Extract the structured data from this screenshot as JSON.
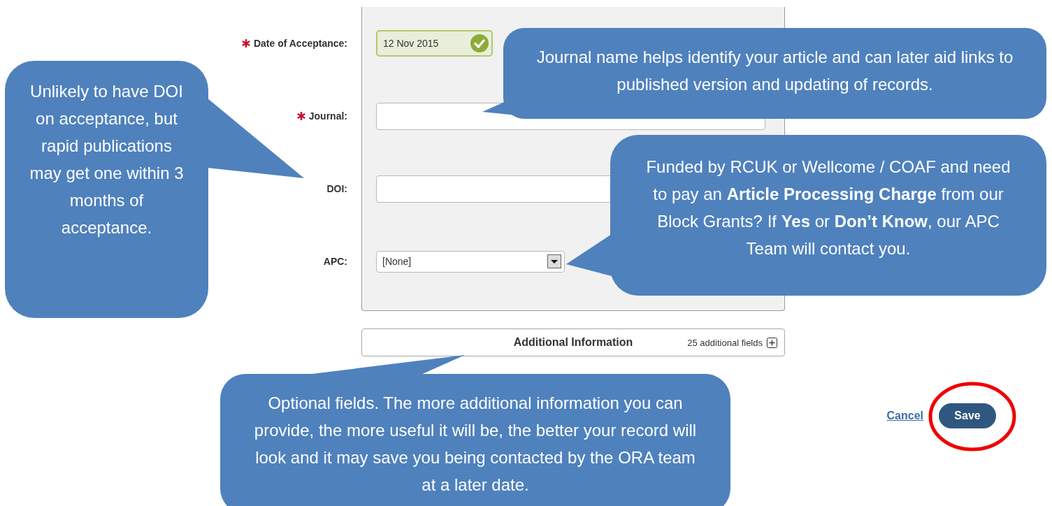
{
  "form": {
    "fields": [
      {
        "label": "Date of Acceptance:",
        "required": true,
        "kind": "date",
        "value": "12 Nov 2015",
        "valid": true
      },
      {
        "label": "Journal:",
        "required": true,
        "kind": "text"
      },
      {
        "label": "DOI:",
        "required": false,
        "kind": "text"
      },
      {
        "label": "APC:",
        "required": false,
        "kind": "select",
        "value": "[None]"
      }
    ]
  },
  "additional_section": {
    "title": "Additional Information",
    "count": "25 additional fields",
    "expanded": false
  },
  "actions": {
    "cancel": "Cancel",
    "save": "Save",
    "save_highlighted": true
  },
  "callouts": [
    {
      "text": "Unlikely to have DOI on acceptance, but rapid publications may get one within 3 months of acceptance."
    },
    {
      "text": "Journal name helps identify your article and can later aid links to published version and updating of records."
    },
    {
      "text": "Funded by RCUK or Wellcome / COAF and need to pay an **Article Processing Charge** from our Block Grants? If **Yes** or **Don’t Know**, our APC Team will contact you."
    },
    {
      "text": "Optional fields. The more additional information you can provide, the more useful it will be, the better your record will look and it may save you being contacted by the ORA team at a later date."
    }
  ]
}
